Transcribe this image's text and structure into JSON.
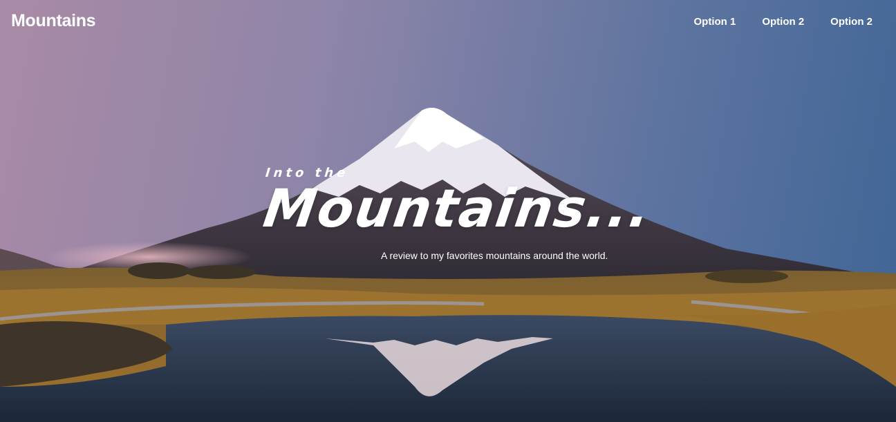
{
  "nav": {
    "brand": "Mountains",
    "links": [
      "Option 1",
      "Option 2",
      "Option 2"
    ]
  },
  "hero": {
    "eyebrow": "Into the",
    "headline": "Mountains...",
    "tagline": "A review to my favorites mountains around the world."
  },
  "colors": {
    "sky_left": "#a98aa6",
    "sky_right": "#3f6596",
    "snow": "#ffffff",
    "grass": "#b5832f",
    "water": "#233349",
    "text": "#ffffff"
  }
}
